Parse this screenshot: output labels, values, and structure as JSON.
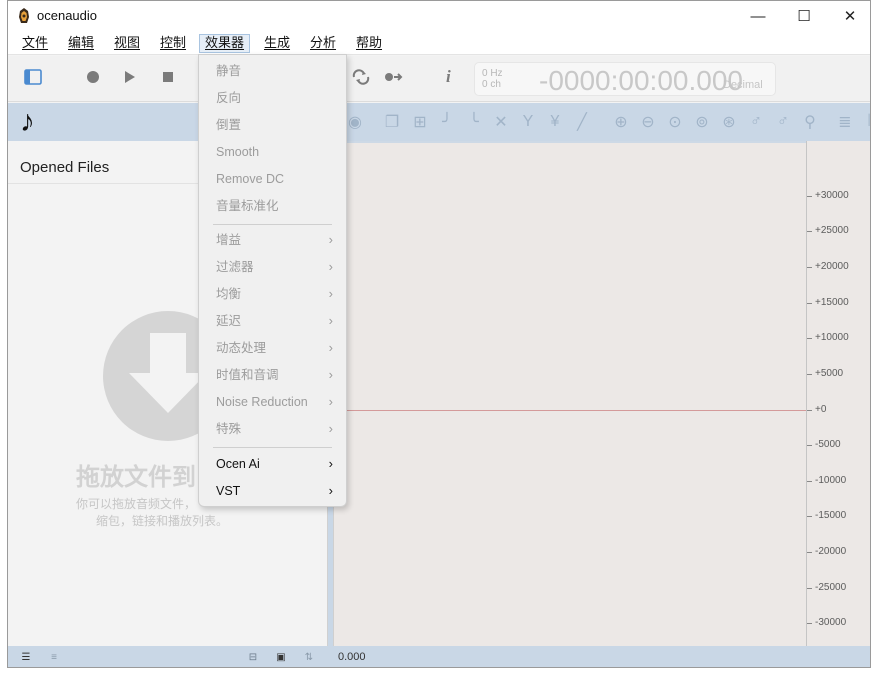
{
  "window": {
    "title": "ocenaudio",
    "minimize_glyph": "—",
    "maximize_glyph": "☐",
    "close_glyph": "✕"
  },
  "menubar": {
    "items": [
      "文件",
      "编辑",
      "视图",
      "控制",
      "效果器",
      "生成",
      "分析",
      "帮助"
    ],
    "active_index": 4
  },
  "toolbar": {
    "icons": [
      "sidebar-toggle-icon",
      "record-icon",
      "play-icon",
      "stop-icon",
      "loop-icon",
      "playhead-icon",
      "info-icon"
    ],
    "display": {
      "hz": "0 Hz",
      "ch": "0 ch",
      "time": "-0000:00:00.000",
      "format": "Decimal"
    }
  },
  "left_panel": {
    "section_title": "Opened Files",
    "drop_title": "拖放文件到",
    "drop_line1": "你可以拖放音频文件，",
    "drop_line2": "缩包，链接和播放列表。"
  },
  "effects_menu": {
    "items": [
      {
        "label": "静音",
        "enabled": false,
        "submenu": false
      },
      {
        "label": "反向",
        "enabled": false,
        "submenu": false
      },
      {
        "label": "倒置",
        "enabled": false,
        "submenu": false
      },
      {
        "label": "Smooth",
        "enabled": false,
        "submenu": false
      },
      {
        "label": "Remove DC",
        "enabled": false,
        "submenu": false
      },
      {
        "label": "音量标准化",
        "enabled": false,
        "submenu": false
      },
      {
        "label": "增益",
        "enabled": false,
        "submenu": true
      },
      {
        "label": "过滤器",
        "enabled": false,
        "submenu": true
      },
      {
        "label": "均衡",
        "enabled": false,
        "submenu": true
      },
      {
        "label": "延迟",
        "enabled": false,
        "submenu": true
      },
      {
        "label": "动态处理",
        "enabled": false,
        "submenu": true
      },
      {
        "label": "时值和音调",
        "enabled": false,
        "submenu": true
      },
      {
        "label": "Noise Reduction",
        "enabled": false,
        "submenu": true
      },
      {
        "label": "特殊",
        "enabled": false,
        "submenu": true
      },
      {
        "label": "Ocen Ai",
        "enabled": true,
        "submenu": true
      },
      {
        "label": "VST",
        "enabled": true,
        "submenu": true
      }
    ],
    "arrow_glyph": "›"
  },
  "ruler": {
    "labels": [
      "+30000",
      "+25000",
      "+20000",
      "+15000",
      "+10000",
      "+5000",
      "+0",
      "-5000",
      "-10000",
      "-15000",
      "-20000",
      "-25000",
      "-30000"
    ]
  },
  "statusbar": {
    "time": "0.000"
  },
  "colors": {
    "panel_blue": "#c9d7e6",
    "waveform_bg": "#ece8e6",
    "zero_line": "#d49a9a"
  }
}
